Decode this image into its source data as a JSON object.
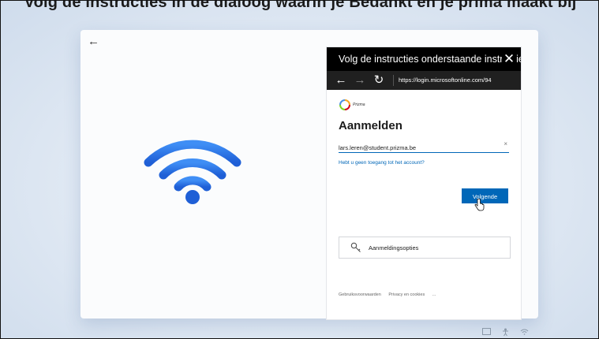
{
  "caption": "Volg de instructies in de dialoog waarin je Bedankt en je prima maakt bij",
  "card": {
    "back_icon": "←"
  },
  "wifi_icon": "wifi-icon",
  "popup": {
    "title": "Volg de instructies onderstaande instructies",
    "close_icon": "✕",
    "browser": {
      "back": "←",
      "forward": "→",
      "refresh": "↻",
      "url": "https://login.microsoftonline.com/94"
    }
  },
  "signin": {
    "logo_text": "Prizma",
    "heading": "Aanmelden",
    "email_value": "lars.leren@student.prizma.be",
    "clear_icon": "×",
    "no_access_link": "Hebt u geen toegang tot het account?",
    "next_button": "Volgende",
    "options_button": "Aanmeldingsopties",
    "footer": {
      "terms": "Gebruiksvoorwaarden",
      "privacy": "Privacy en cookies",
      "more": "..."
    }
  },
  "colors": {
    "accent": "#0067b8",
    "wifi": "#2c6ee8",
    "title_bar": "#000000",
    "browser_bar": "#202020"
  }
}
